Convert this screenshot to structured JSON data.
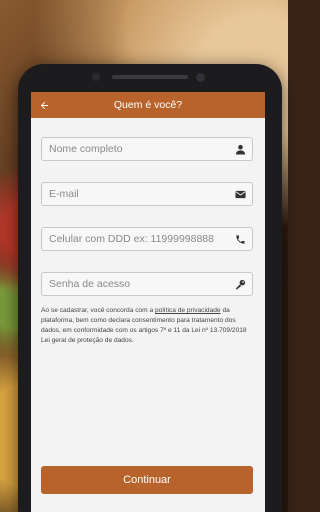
{
  "header": {
    "title": "Quem é você?",
    "back_icon": "arrow-left-icon"
  },
  "form": {
    "name": {
      "placeholder": "Nome completo",
      "value": "",
      "icon": "user-icon"
    },
    "email": {
      "placeholder": "E-mail",
      "value": "",
      "icon": "envelope-icon"
    },
    "phone": {
      "placeholder": "Celular com DDD ex: 11999998888",
      "value": "",
      "icon": "phone-icon"
    },
    "password": {
      "placeholder": "Senha de acesso",
      "value": "",
      "icon": "key-icon"
    }
  },
  "terms": {
    "prefix": "Ao se cadastrar, você concorda com a ",
    "link": "política de privacidade",
    "suffix": " da plataforma, bem como declara consentimento para tratamento dos dados, em conformidade com os artigos 7º e 11 da Lei nº 13.709/2018 Lei geral de proteção de dados."
  },
  "actions": {
    "continue_label": "Continuar"
  },
  "colors": {
    "accent": "#b8632c",
    "background": "#f3f3f3"
  }
}
